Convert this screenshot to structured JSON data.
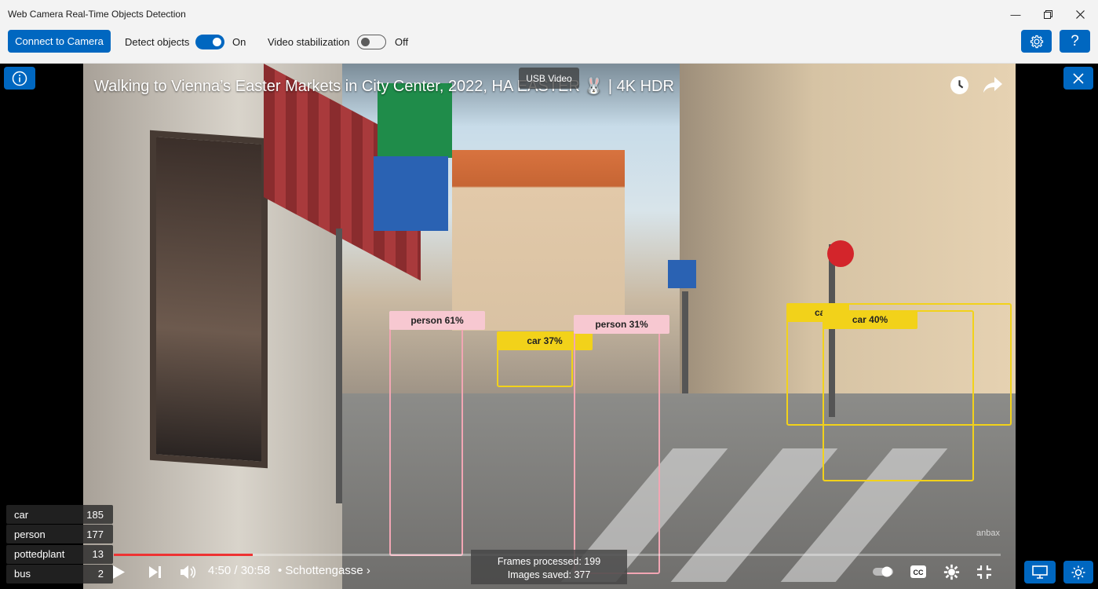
{
  "window": {
    "title": "Web Camera Real-Time Objects Detection"
  },
  "toolbar": {
    "connect_label": "Connect to Camera",
    "detect_label": "Detect objects",
    "detect_state": "On",
    "stabilization_label": "Video stabilization",
    "stabilization_state": "Off"
  },
  "video": {
    "title": "Walking to Vienna’s Easter Markets in City Center, 2022, HA    EASTER 🐰 | 4K HDR",
    "source_badge": "USB Video",
    "watermark": "anbax",
    "time": "4:50 / 30:58",
    "chapter": "• Schottengasse ›",
    "progress_fraction": 0.157
  },
  "detections": [
    {
      "label": "person 61%",
      "kind": "person"
    },
    {
      "label": "car 37%",
      "kind": "car"
    },
    {
      "label": "person 31%",
      "kind": "person"
    },
    {
      "label": "car 40%",
      "kind": "car"
    },
    {
      "label": "ca",
      "kind": "car"
    }
  ],
  "counts": [
    {
      "name": "car",
      "value": "185"
    },
    {
      "name": "person",
      "value": "177"
    },
    {
      "name": "pottedplant",
      "value": "13"
    },
    {
      "name": "bus",
      "value": "2"
    }
  ],
  "stats": {
    "frames": "Frames processed: 199",
    "images": "Images saved: 377"
  },
  "colors": {
    "accent": "#0067c0",
    "person_box": "#f2a6b4",
    "car_box": "#f2d21a"
  }
}
